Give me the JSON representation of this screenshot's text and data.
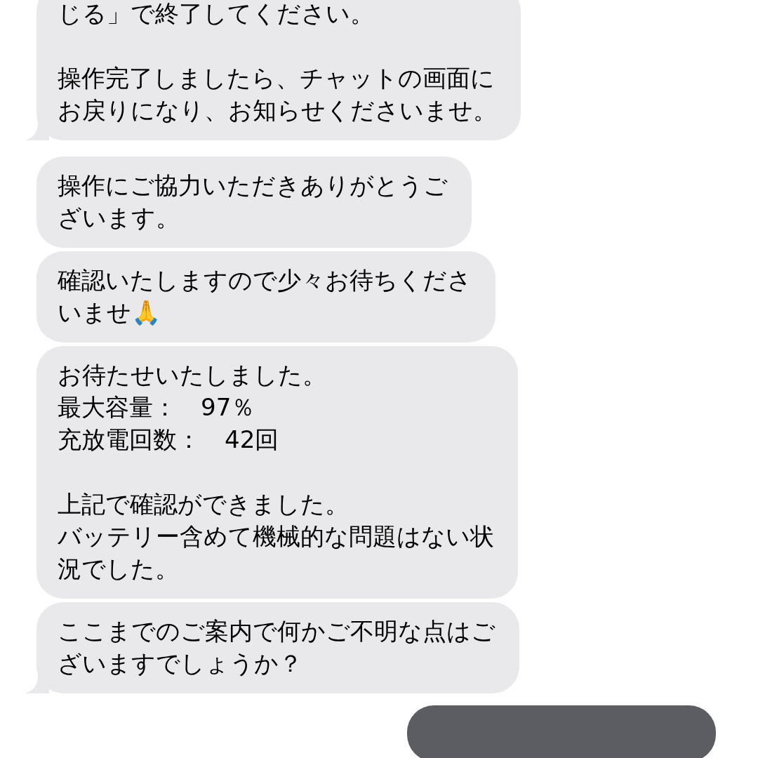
{
  "messages": [
    {
      "kind": "incoming",
      "tail": true,
      "paragraphs": [
        [
          "じる」で終了してください。"
        ],
        [
          "操作完了しましたら、チャットの画面に",
          "お戻りになり、お知らせくださいませ。"
        ]
      ]
    },
    {
      "kind": "incoming",
      "tail": false,
      "paragraphs": [
        [
          "操作にご協力いただきありがとうご",
          "ざいます。"
        ]
      ]
    },
    {
      "kind": "incoming",
      "tail": false,
      "paragraphs": [
        [
          "確認いたしますので少々お待ちくださ",
          "いませ🙏"
        ]
      ]
    },
    {
      "kind": "incoming",
      "tail": false,
      "paragraphs": [
        [
          "お待たせいたしました。",
          "最大容量：　97％",
          "充放電回数：　42回"
        ],
        [
          "上記で確認ができました。",
          "バッテリー含めて機械的な問題はない状",
          "況でした。"
        ]
      ]
    },
    {
      "kind": "incoming",
      "tail": true,
      "paragraphs": [
        [
          "ここまでのご案内で何かご不明な点はご",
          "ざいますでしょうか？"
        ]
      ]
    },
    {
      "kind": "outgoing"
    }
  ]
}
